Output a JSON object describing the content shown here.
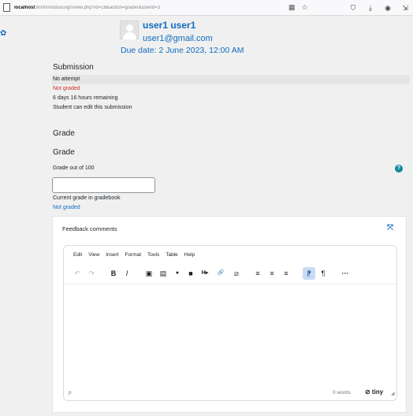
{
  "browser": {
    "url_host": "localhost",
    "url_rest": ":8000/mod/assign/view.php?id=16&action=grader&userid=3",
    "icons": [
      "page-icon",
      "reader-icon",
      "star-icon",
      "shield-icon",
      "download-icon",
      "extension-icon",
      "menu-icon"
    ]
  },
  "header": {
    "user_name": "user1 user1",
    "email": "user1@gmail.com",
    "due_date": "Due date: 2 June 2023, 12:00 AM"
  },
  "submission": {
    "title": "Submission",
    "attempt": "No attempt",
    "grading_status": "Not graded",
    "time_remaining": "6 days 16 hours remaining",
    "edit_status": "Student can edit this submission"
  },
  "grade": {
    "section_title": "Grade",
    "subsection_title": "Grade",
    "grade_out_of_label": "Grade out of 100",
    "grade_value": "",
    "current_grade_label": "Current grade in gradebook",
    "current_grade_value": "Not graded"
  },
  "feedback": {
    "title": "Feedback comments",
    "menu": [
      "Edit",
      "View",
      "Insert",
      "Format",
      "Tools",
      "Table",
      "Help"
    ],
    "toolbar": {
      "undo": "↶",
      "redo": "↷",
      "bold": "B",
      "italic": "I",
      "image": "▣",
      "media": "▤",
      "record_audio": "●",
      "record_video": "■",
      "h5p": "H▸",
      "link": "🔗",
      "unlink": "⧄",
      "align_left": "≡",
      "align_center": "≡",
      "align_right": "≡",
      "ltr": "⁋",
      "rtl": "¶",
      "more": "···"
    },
    "status_path": "p",
    "word_count": "0 words",
    "brand": "⊘ tiny"
  },
  "colors": {
    "link": "#0f6cbf",
    "error": "#ca3120",
    "accent": "#0f8a9c"
  }
}
